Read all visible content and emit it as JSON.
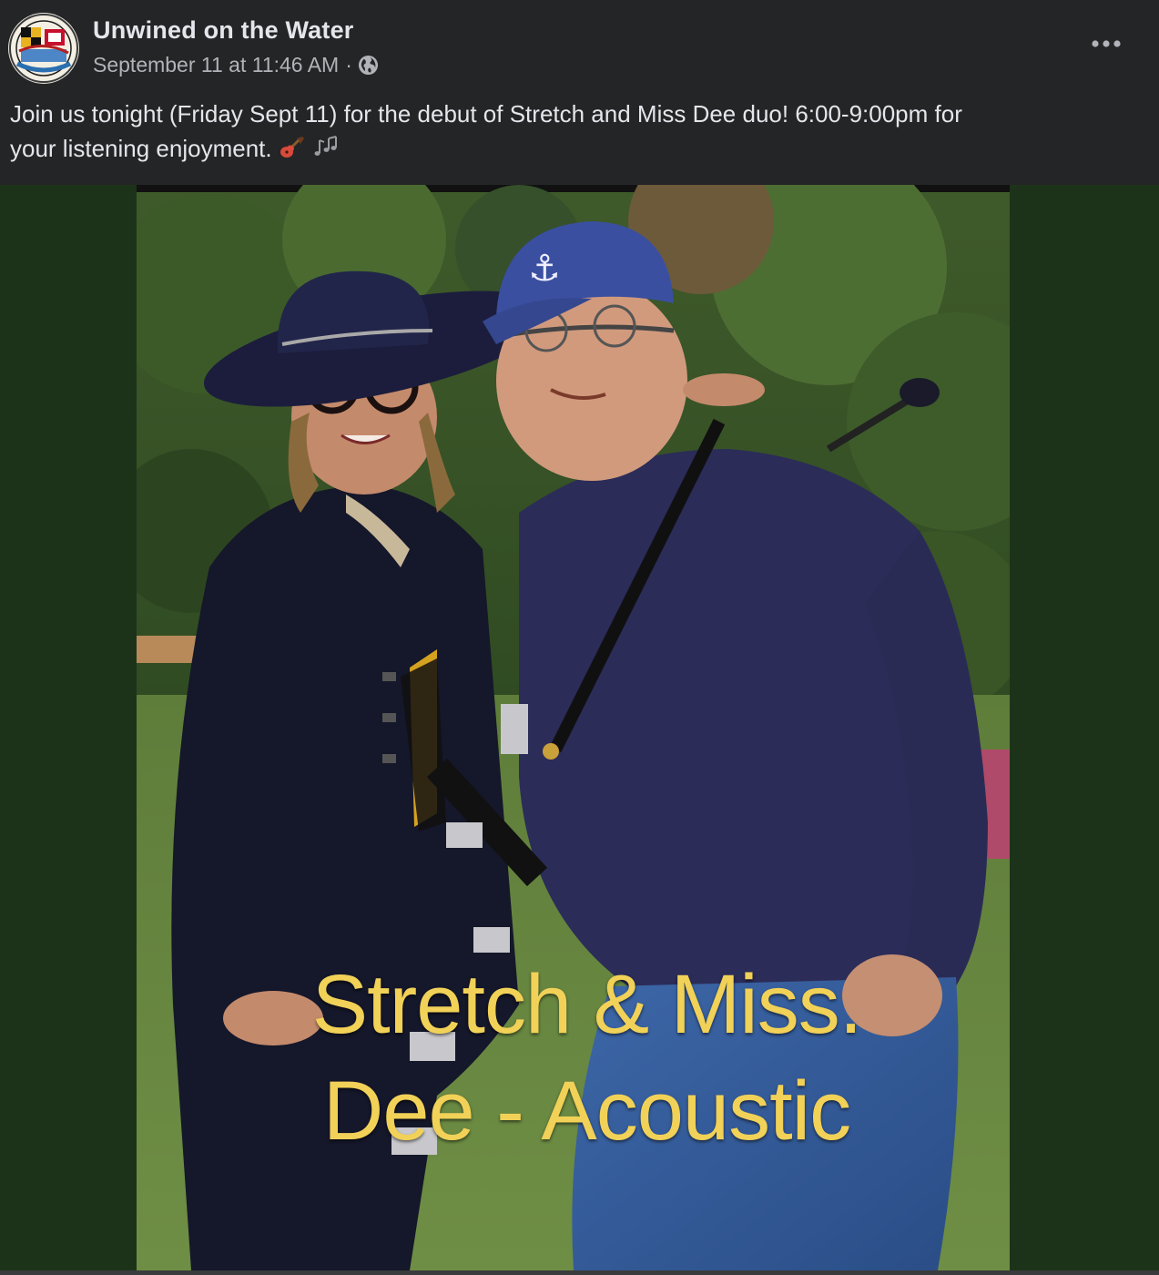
{
  "post": {
    "page_name": "Unwined on the Water",
    "timestamp": "September 11 at 11:46 AM",
    "separator": "·",
    "audience_icon": "globe-icon",
    "more_icon": "more-options-icon",
    "text_line_1": "Join us tonight (Friday Sept 11) for the debut of Stretch and Miss Dee duo!  6:00-9:00pm for",
    "text_line_2": "your listening enjoyment.",
    "emoji_icons": [
      "guitar-emoji-icon",
      "music-notes-emoji-icon"
    ]
  },
  "photo": {
    "caption_line_1": "Stretch & Miss.",
    "caption_line_2": "Dee - Acoustic"
  },
  "colors": {
    "background": "#242526",
    "text_primary": "#e4e6eb",
    "text_secondary": "#b0b3b8",
    "photo_letterbox": "#1d3319",
    "caption": "#f1d157"
  }
}
